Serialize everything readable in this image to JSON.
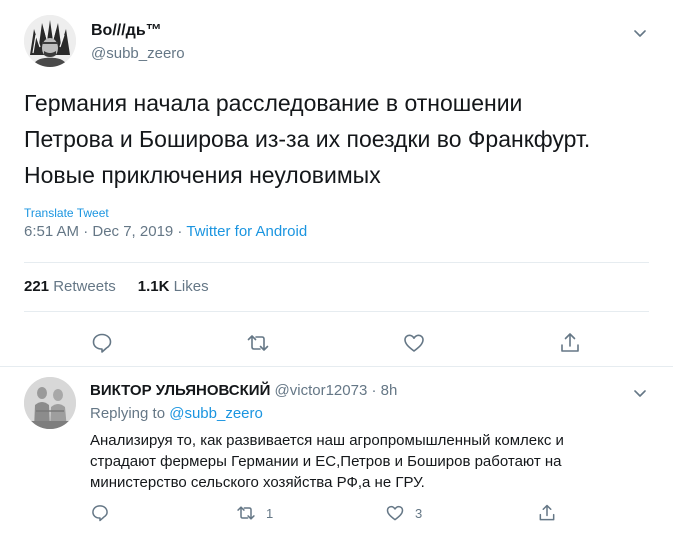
{
  "main_tweet": {
    "author_name": "Bo///дь™",
    "author_handle": "@subb_zeero",
    "text_lines": [
      "Германия начала расследование в отношении",
      "Петрова и Боширова из-за их поездки во Франкфурт.",
      "Новые приключения неуловимых"
    ],
    "translate_label": "Translate Tweet",
    "timestamp": "6:51 AM · Dec 7, 2019 · ",
    "source": "Twitter for Android",
    "retweets_count": "221",
    "retweets_label": "Retweets",
    "likes_count": "1.1K",
    "likes_label": "Likes"
  },
  "reply": {
    "author_name": "ВИКТОР УЛЬЯНОВСКИЙ",
    "author_handle_time": " @victor12073 · 8h",
    "replying_prefix": "Replying to ",
    "replying_mention": "@subb_zeero",
    "text_lines": [
      "Анализируя то, как развивается наш агропромышленный комлекс и",
      "страдают фермеры Германии и ЕС,Петров и Боширов работают на",
      "министерство сельского хозяйства РФ,а не ГРУ."
    ],
    "retweet_count": "1",
    "like_count": "3"
  },
  "icons": {
    "chevron": "chevron-down-icon",
    "reply": "comment-icon",
    "retweet": "retweet-icon",
    "like": "heart-icon",
    "share": "share-icon"
  },
  "colors": {
    "text": "#14171a",
    "secondary": "#657786",
    "link": "#1b95e0",
    "divider": "#e6ecf0"
  }
}
